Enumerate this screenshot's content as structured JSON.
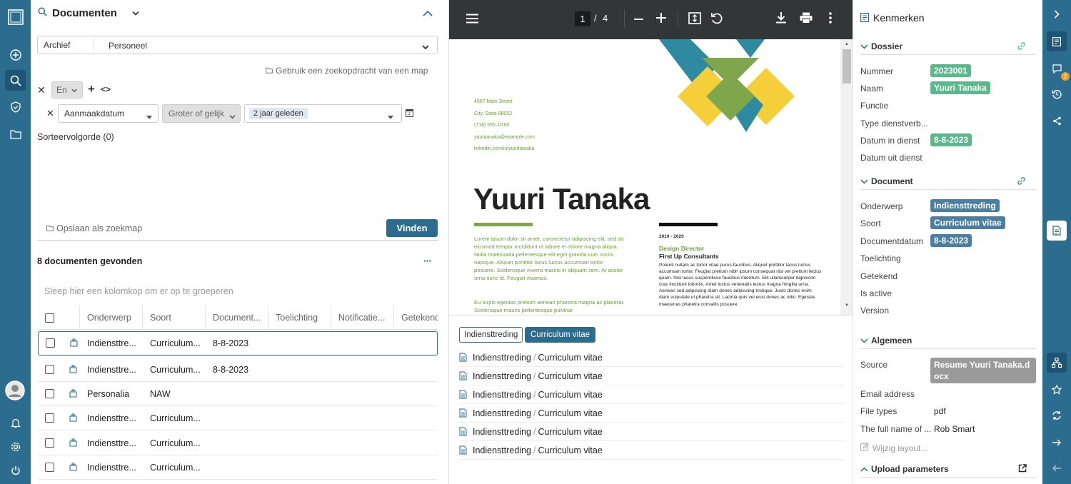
{
  "search": {
    "title": "Documenten",
    "archive_label": "Archief",
    "archive_value": "Personeel",
    "use_query": "Gebruik een zoekopdracht van een map",
    "operator": "En",
    "condition": {
      "field": "Aanmaakdatum",
      "op": "Groter of gelijk",
      "value": "2 jaar geleden"
    },
    "sort_order": "Sorteervolgorde (0)",
    "save_folder": "Opslaan als zoekmap",
    "find_button": "Vinden"
  },
  "results": {
    "count_label": "8 documenten gevonden",
    "group_hint": "Sleep hier een kolomkop om er op te groeperen",
    "columns": [
      "Onderwerp",
      "Soort",
      "Document...",
      "Toelichting",
      "Notificatie...",
      "Getekend"
    ],
    "rows": [
      {
        "onderwerp": "Indiensttre...",
        "soort": "Curriculum...",
        "datum": "8-8-2023"
      },
      {
        "onderwerp": "Indiensttre...",
        "soort": "Curriculum...",
        "datum": "8-8-2023"
      },
      {
        "onderwerp": "Personalia",
        "soort": "NAW",
        "datum": ""
      },
      {
        "onderwerp": "Indiensttre...",
        "soort": "Curriculum...",
        "datum": ""
      },
      {
        "onderwerp": "Indiensttre...",
        "soort": "Curriculum...",
        "datum": ""
      },
      {
        "onderwerp": "Indiensttre...",
        "soort": "Curriculum...",
        "datum": ""
      }
    ]
  },
  "viewer": {
    "page_current": "1",
    "page_sep": "/",
    "page_total": "4",
    "resume": {
      "address": [
        "4567 Main Street",
        "City, State 98052",
        "(718) 555–0100",
        "yuuritanaka@example.com",
        "linkedin.com/in/yuuritanaka"
      ],
      "name": "Yuuri Tanaka",
      "summary1": "Lorem ipsum dolor sit amet, consectetur adipiscing elit, sed do eiusmod tempor incididunt ut labore et dolore magna aliqua. Nulla malesuada pellentesque elit eget gravida cum sociis natoque. Aliquet porttitor lacus luctus accumsan tortor posuere. Scelerisque viverra mauris in aliquam sem. At auctor urna nunc id. Feugiat vivamus.",
      "summary2": "Eu turpis egestas pretium aenean pharetra magna ac placerat. Scelerisque mauris pellentesque pulvinar",
      "years": "2019 - 2020",
      "job_title": "Design Director",
      "company": "First Up Consultants",
      "job_text": "Potenti nullam ac tortor vitae purus faucibus. Aliquet porttitor lacus luctus accumsan tortor. Feugiat pretium nibh ipsum consequat nisl vel pretium lectus quam. Nisi lacus suspendisse faucibus interdum. Elit ullamcorper dignissim cras tincidunt lobortis. Amet luctus venenatis lectus magna fringilla urna. Aenean sed adipiscing diam donec adipiscing tristique. Justo donec enim diam vulputate ut pharetra sit. Lacinia quis vel eros donec ac odio. Egestas maecenas pharetra convallis posuere."
    }
  },
  "related": {
    "tabs": [
      "Indiensttreding",
      "Curriculum vitae"
    ],
    "items": [
      {
        "a": "Indiensttreding",
        "sep": "/",
        "b": "Curriculum vitae"
      },
      {
        "a": "Indiensttreding",
        "sep": "/",
        "b": "Curriculum vitae"
      },
      {
        "a": "Indiensttreding",
        "sep": "/",
        "b": "Curriculum vitae"
      },
      {
        "a": "Indiensttreding",
        "sep": "/",
        "b": "Curriculum vitae"
      },
      {
        "a": "Indiensttreding",
        "sep": "/",
        "b": "Curriculum vitae"
      },
      {
        "a": "Indiensttreding",
        "sep": "/",
        "b": "Curriculum vitae"
      }
    ]
  },
  "props": {
    "title": "Kenmerken",
    "dossier": {
      "title": "Dossier",
      "nummer_label": "Nummer",
      "nummer": "2023001",
      "naam_label": "Naam",
      "naam": "Yuuri Tanaka",
      "functie_label": "Functie",
      "type_label": "Type dienstverb...",
      "datum_in_label": "Datum in dienst",
      "datum_in": "8-8-2023",
      "datum_uit_label": "Datum uit dienst"
    },
    "document": {
      "title": "Document",
      "onderwerp_label": "Onderwerp",
      "onderwerp": "Indiensttreding",
      "soort_label": "Soort",
      "soort": "Curriculum vitae",
      "datum_label": "Documentdatum",
      "datum": "8-8-2023",
      "toelichting_label": "Toelichting",
      "getekend_label": "Getekend",
      "active_label": "Is active",
      "version_label": "Version"
    },
    "algemeen": {
      "title": "Algemeen",
      "source_label": "Source",
      "source": "Resume Yuuri Tanaka.docx",
      "email_label": "Email address",
      "filetypes_label": "File types",
      "filetypes": "pdf",
      "fullname_label": "The full name of ...",
      "fullname": "Rob Smart",
      "change_layout": "Wijzig layout..."
    },
    "upload": {
      "title": "Upload parameters"
    }
  },
  "right_rail": {
    "badge": "2"
  },
  "colors": {
    "rail": "#2c6c8e",
    "accent": "#2c6c8e",
    "tag_green": "#5bb88a",
    "tag_blue": "#4a7fa3",
    "viewer_bar": "#323639"
  }
}
